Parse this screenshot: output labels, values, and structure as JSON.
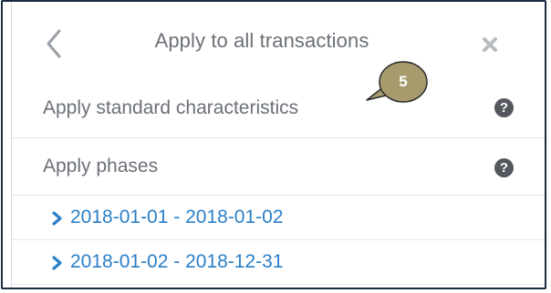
{
  "header": {
    "title": "Apply to all transactions",
    "back_icon": "chevron-left-icon",
    "close_icon": "close-icon"
  },
  "callout": {
    "number": "5",
    "color": "#a79a6d"
  },
  "rows": {
    "standard": {
      "label": "Apply standard characteristics",
      "help_icon": "question-circle-icon",
      "help_glyph": "?"
    },
    "phases": {
      "label": "Apply phases",
      "help_icon": "question-circle-icon",
      "help_glyph": "?"
    }
  },
  "phases": [
    {
      "label": "2018-01-01 - 2018-01-02",
      "icon": "chevron-right-icon"
    },
    {
      "label": "2018-01-02 - 2018-12-31",
      "icon": "chevron-right-icon"
    }
  ],
  "colors": {
    "link": "#2a7fc8",
    "text": "#6b7078",
    "help_bg": "#54585e",
    "frame_border": "#1a2a40"
  }
}
